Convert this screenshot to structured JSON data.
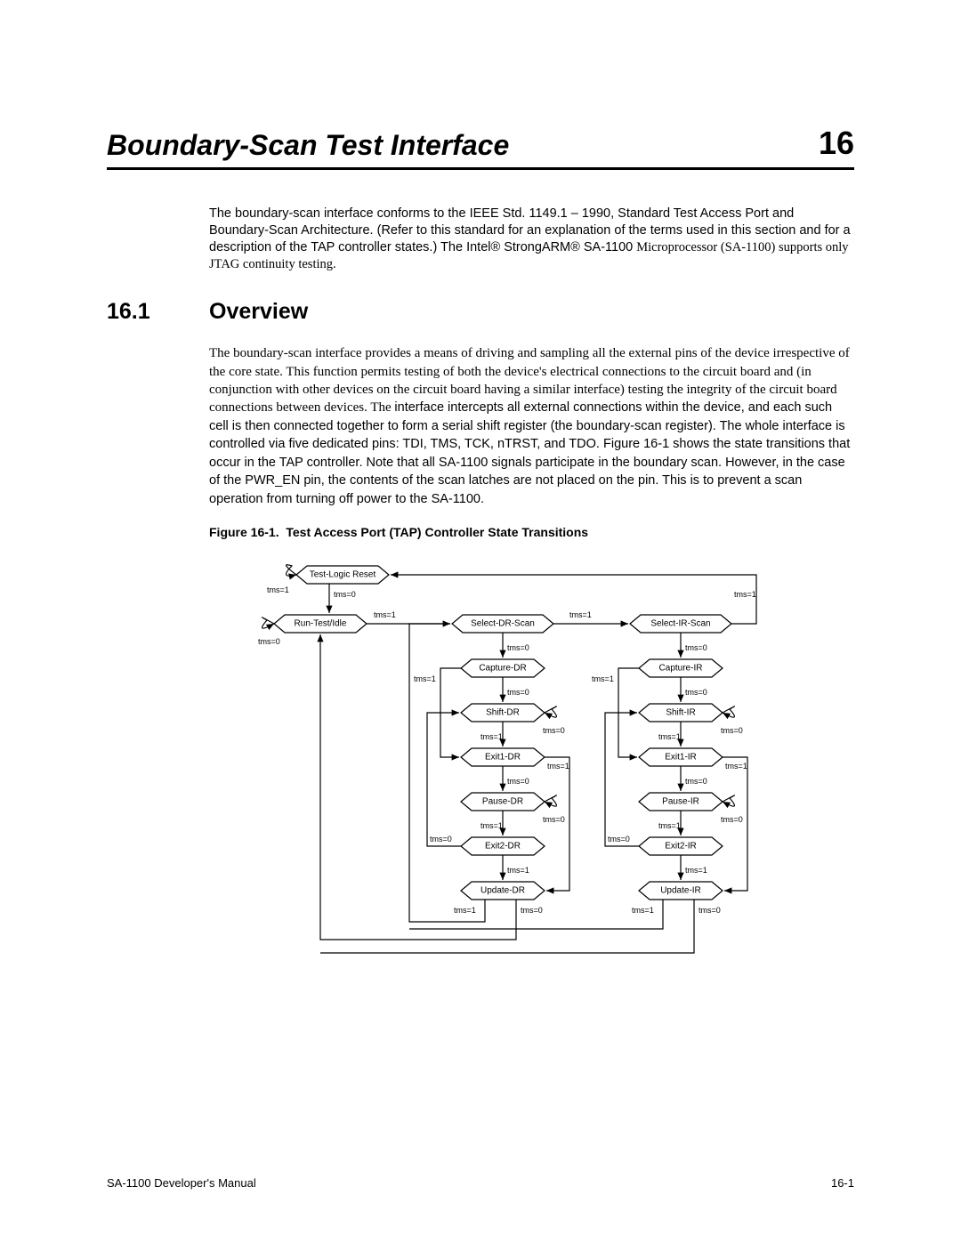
{
  "chapter": {
    "title": "Boundary-Scan Test Interface",
    "number": "16"
  },
  "intro": {
    "line1a": "The boundary-scan interface conforms to the IEEE Std. 1149.1 ",
    "line1b": " – 1990, Standard Test Access Port",
    "line2a": "and Boundary-Scan Architecture. ",
    "line2b": "(Refer to this standard for an explanation of the terms used in",
    "line3": "this section and for a description of the TAP controller states.)  The Intel® StrongARM® SA-1100",
    "line4": "Microprocessor (SA-1100) supports only JTAG continuity testing."
  },
  "section": {
    "num": "16.1",
    "title": "Overview"
  },
  "overview": {
    "p1": "The boundary-scan interface provides a means of driving and sampling all the external pins of the device irrespective of the core state. This function permits testing of both the device's electrical connections to the circuit board and (in conjunction with other devices on the circuit board having a similar interface) testing the integrity of the circuit board connections between devices. The",
    "p2a": "interface intercepts all external connections within the device, and each such  cell  is then connected together to form a serial shift register (the boundary-scan register). The whole interface is controlled via five dedicated pins: TDI, TMS, TCK, nTRST, and TDO. ",
    "p2b": "Figure 16-1",
    "p2c": " shows the state transitions that occur in the TAP controller. Note that all SA-1100 signals participate in the boundary scan. However, in the case of the PWR_EN pin, the contents of the scan latches are not placed on the pin. This is to prevent a scan operation from turning off power to the SA-1100."
  },
  "figure": {
    "label": "Figure 16-1.",
    "caption": "Test Access Port (TAP) Controller State Transitions"
  },
  "chart_data": {
    "type": "state-diagram",
    "title": "Test Access Port (TAP) Controller State Transitions",
    "states": [
      "Test-Logic Reset",
      "Run-Test/Idle",
      "Select-DR-Scan",
      "Select-IR-Scan",
      "Capture-DR",
      "Shift-DR",
      "Exit1-DR",
      "Pause-DR",
      "Exit2-DR",
      "Update-DR",
      "Capture-IR",
      "Shift-IR",
      "Exit1-IR",
      "Pause-IR",
      "Exit2-IR",
      "Update-IR"
    ],
    "transitions": [
      {
        "from": "Test-Logic Reset",
        "to": "Test-Logic Reset",
        "tms": 1
      },
      {
        "from": "Test-Logic Reset",
        "to": "Run-Test/Idle",
        "tms": 0
      },
      {
        "from": "Run-Test/Idle",
        "to": "Run-Test/Idle",
        "tms": 0
      },
      {
        "from": "Run-Test/Idle",
        "to": "Select-DR-Scan",
        "tms": 1
      },
      {
        "from": "Select-DR-Scan",
        "to": "Select-IR-Scan",
        "tms": 1
      },
      {
        "from": "Select-DR-Scan",
        "to": "Capture-DR",
        "tms": 0
      },
      {
        "from": "Select-IR-Scan",
        "to": "Test-Logic Reset",
        "tms": 1
      },
      {
        "from": "Select-IR-Scan",
        "to": "Capture-IR",
        "tms": 0
      },
      {
        "from": "Capture-DR",
        "to": "Shift-DR",
        "tms": 0
      },
      {
        "from": "Capture-DR",
        "to": "Exit1-DR",
        "tms": 1
      },
      {
        "from": "Shift-DR",
        "to": "Shift-DR",
        "tms": 0
      },
      {
        "from": "Shift-DR",
        "to": "Exit1-DR",
        "tms": 1
      },
      {
        "from": "Exit1-DR",
        "to": "Pause-DR",
        "tms": 0
      },
      {
        "from": "Exit1-DR",
        "to": "Update-DR",
        "tms": 1
      },
      {
        "from": "Pause-DR",
        "to": "Pause-DR",
        "tms": 0
      },
      {
        "from": "Pause-DR",
        "to": "Exit2-DR",
        "tms": 1
      },
      {
        "from": "Exit2-DR",
        "to": "Shift-DR",
        "tms": 0
      },
      {
        "from": "Exit2-DR",
        "to": "Update-DR",
        "tms": 1
      },
      {
        "from": "Update-DR",
        "to": "Run-Test/Idle",
        "tms": 0
      },
      {
        "from": "Update-DR",
        "to": "Select-DR-Scan",
        "tms": 1
      },
      {
        "from": "Capture-IR",
        "to": "Shift-IR",
        "tms": 0
      },
      {
        "from": "Capture-IR",
        "to": "Exit1-IR",
        "tms": 1
      },
      {
        "from": "Shift-IR",
        "to": "Shift-IR",
        "tms": 0
      },
      {
        "from": "Shift-IR",
        "to": "Exit1-IR",
        "tms": 1
      },
      {
        "from": "Exit1-IR",
        "to": "Pause-IR",
        "tms": 0
      },
      {
        "from": "Exit1-IR",
        "to": "Update-IR",
        "tms": 1
      },
      {
        "from": "Pause-IR",
        "to": "Pause-IR",
        "tms": 0
      },
      {
        "from": "Pause-IR",
        "to": "Exit2-IR",
        "tms": 1
      },
      {
        "from": "Exit2-IR",
        "to": "Shift-IR",
        "tms": 0
      },
      {
        "from": "Exit2-IR",
        "to": "Update-IR",
        "tms": 1
      },
      {
        "from": "Update-IR",
        "to": "Run-Test/Idle",
        "tms": 0
      },
      {
        "from": "Update-IR",
        "to": "Select-DR-Scan",
        "tms": 1
      }
    ]
  },
  "dl": {
    "tlr": "Test-Logic Reset",
    "rti": "Run-Test/Idle",
    "sdr": "Select-DR-Scan",
    "sir": "Select-IR-Scan",
    "cdr": "Capture-DR",
    "shdr": "Shift-DR",
    "e1dr": "Exit1-DR",
    "pdr": "Pause-DR",
    "e2dr": "Exit2-DR",
    "udr": "Update-DR",
    "cir": "Capture-IR",
    "shir": "Shift-IR",
    "e1ir": "Exit1-IR",
    "pir": "Pause-IR",
    "e2ir": "Exit2-IR",
    "uir": "Update-IR",
    "t0": "tms=0",
    "t1": "tms=1"
  },
  "footer": {
    "left": "SA-1100 Developer's Manual",
    "right": "16-1"
  }
}
